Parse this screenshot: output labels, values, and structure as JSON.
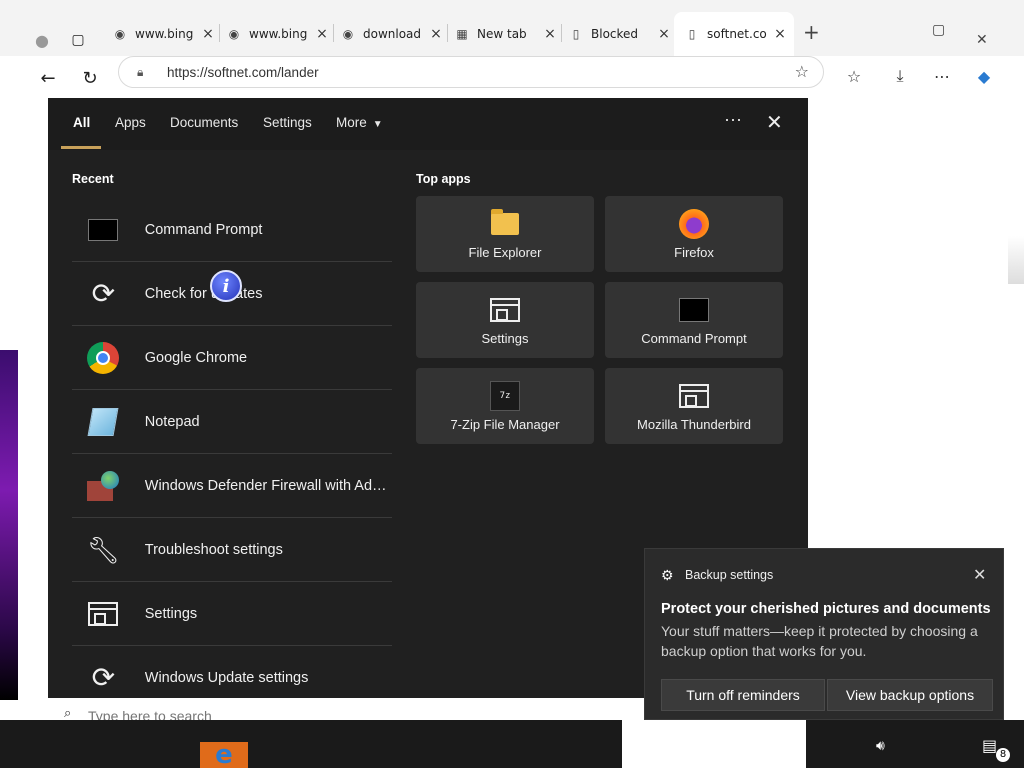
{
  "browser": {
    "tabs": [
      {
        "title": "www.bing",
        "icon": "bing-favicon"
      },
      {
        "title": "www.bing",
        "icon": "bing-favicon"
      },
      {
        "title": "download",
        "icon": "download-favicon"
      },
      {
        "title": "New tab",
        "icon": "new-tab-favicon"
      },
      {
        "title": "Blocked",
        "icon": "page-favicon"
      },
      {
        "title": "softnet.co",
        "icon": "page-favicon"
      }
    ],
    "new_tab_symbol": "+",
    "close_symbol": "✕",
    "address": "https://softnet.com/lander"
  },
  "search_panel": {
    "tabs": [
      "All",
      "Apps",
      "Documents",
      "Settings",
      "More"
    ],
    "recent_title": "Recent",
    "top_apps_title": "Top apps",
    "recent": [
      {
        "label": "Command Prompt",
        "icon": "command-prompt-icon"
      },
      {
        "label": "Check for updates",
        "icon": "refresh-icon"
      },
      {
        "label": "Google Chrome",
        "icon": "chrome-icon"
      },
      {
        "label": "Notepad",
        "icon": "notepad-icon"
      },
      {
        "label": "Windows Defender Firewall with Advanced Security",
        "icon": "firewall-icon"
      },
      {
        "label": "Troubleshoot settings",
        "icon": "wrench-icon"
      },
      {
        "label": "Settings",
        "icon": "settings-icon"
      },
      {
        "label": "Windows Update settings",
        "icon": "refresh-icon"
      }
    ],
    "top_apps": [
      {
        "label": "File Explorer",
        "icon": "folder-icon"
      },
      {
        "label": "Firefox",
        "icon": "firefox-icon"
      },
      {
        "label": "Settings",
        "icon": "settings-icon"
      },
      {
        "label": "Command Prompt",
        "icon": "command-prompt-icon"
      },
      {
        "label": "7-Zip File Manager",
        "icon": "zip-icon"
      },
      {
        "label": "Mozilla Thunderbird",
        "icon": "thunderbird-icon"
      }
    ],
    "search_placeholder": "Type here to search"
  },
  "toast": {
    "app_name": "Backup settings",
    "title": "Protect your cherished pictures and documents",
    "body": "Your stuff matters—keep it protected by choosing a backup option that works for you.",
    "button_1": "Turn off reminders",
    "button_2": "View backup options"
  },
  "taskbar": {
    "notification_count": "8"
  },
  "colors": {
    "panel_bg": "#202020",
    "tile_bg": "#333333",
    "accent_underline": "#c8a15a",
    "toast_bg": "#2b2b2b"
  }
}
